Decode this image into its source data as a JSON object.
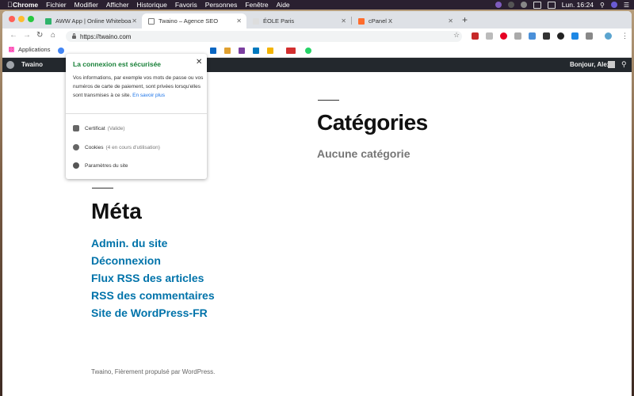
{
  "menubar": {
    "items": [
      "Chrome",
      "Fichier",
      "Modifier",
      "Afficher",
      "Historique",
      "Favoris",
      "Personnes",
      "Fenêtre",
      "Aide"
    ],
    "clock": "Lun. 16:24"
  },
  "tabs": [
    {
      "label": "AWW App | Online Whiteboard",
      "favicon_color": "#2fb36b"
    },
    {
      "label": "Twaino – Agence SEO",
      "favicon_color": "#777777"
    },
    {
      "label": "ÉOLE Paris",
      "favicon_color": "#dddddd"
    },
    {
      "label": "cPanel X",
      "favicon_color": "#ff6c2c"
    }
  ],
  "address": {
    "url": "https://twaino.com"
  },
  "bookmarks": {
    "apps_label": "Applications"
  },
  "wp_admin_bar": {
    "site": "Twaino",
    "fragment": "e",
    "greeting": "Bonjour, Alex"
  },
  "popup": {
    "title": "La connexion est sécurisée",
    "description": "Vos informations, par exemple vos mots de passe ou vos numéros de carte de paiement, sont privées lorsqu'elles sont transmises à ce site.",
    "learn_more": "En savoir plus",
    "certificate": {
      "label": "Certificat",
      "status": "(Valide)"
    },
    "cookies": {
      "label": "Cookies",
      "status": "(4 en cours d'utilisation)"
    },
    "site_settings": "Paramètres du site"
  },
  "content": {
    "categories_title": "Catégories",
    "no_categories": "Aucune catégorie",
    "meta_title": "Méta",
    "meta_links": [
      "Admin. du site",
      "Déconnexion",
      "Flux RSS des articles",
      "RSS des commentaires",
      "Site de WordPress-FR"
    ],
    "footer": "Twaino, Fièrement propulsé par WordPress."
  },
  "colors": {
    "secure_green": "#188038",
    "link_blue": "#0073aa",
    "wp_bar": "#23282d"
  }
}
